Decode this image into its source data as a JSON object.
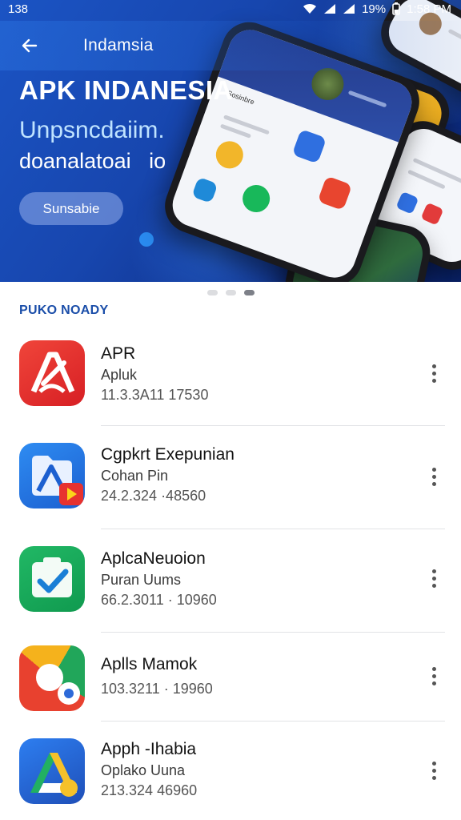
{
  "status_bar": {
    "time_left": "138",
    "battery": "19%",
    "time_right": "1:58 PM"
  },
  "app_bar": {
    "title": "Indamsia",
    "back_icon": "arrow-left-icon"
  },
  "banner": {
    "title": "APK INDANESIA",
    "subtitle_line1": "Unpsncdaiim.",
    "subtitle_line2": "doanalatoai   io",
    "button_label": "Sunsabie",
    "phone_screen_heading": "Sosinbre",
    "page_index": 3,
    "page_count": 3
  },
  "section": {
    "title": "PUKO NOADY"
  },
  "apps": [
    {
      "name": "APR",
      "line2": "Apluk",
      "meta": "11.3.3A11   17530",
      "icon": "red-a-logo-icon",
      "more_icon": "more-vert-icon"
    },
    {
      "name": "Cgpkrt Exepunian",
      "line2": "Cohan Pin",
      "meta": "24.2.324   ·48560",
      "icon": "blue-a-file-play-icon",
      "more_icon": "more-vert-icon"
    },
    {
      "name": "AplcaNeuoion",
      "line2": "Puran Uums",
      "meta": "66.2.3011 · 10960",
      "icon": "green-check-icon",
      "more_icon": "more-vert-icon"
    },
    {
      "name": "Aplls Mamok",
      "line2": "",
      "meta": "103.3211 · 19960",
      "icon": "colorful-ring-icon",
      "more_icon": "more-vert-icon"
    },
    {
      "name": "Apph -Ihabia",
      "line2": "Oplako Uuna",
      "meta": "213.324   46960",
      "icon": "drive-a-icon",
      "more_icon": "more-vert-icon"
    }
  ],
  "colors": {
    "hero_blue": "#1746ae",
    "section_title": "#1b4ea9",
    "accent_light": "#bfe3ff"
  }
}
